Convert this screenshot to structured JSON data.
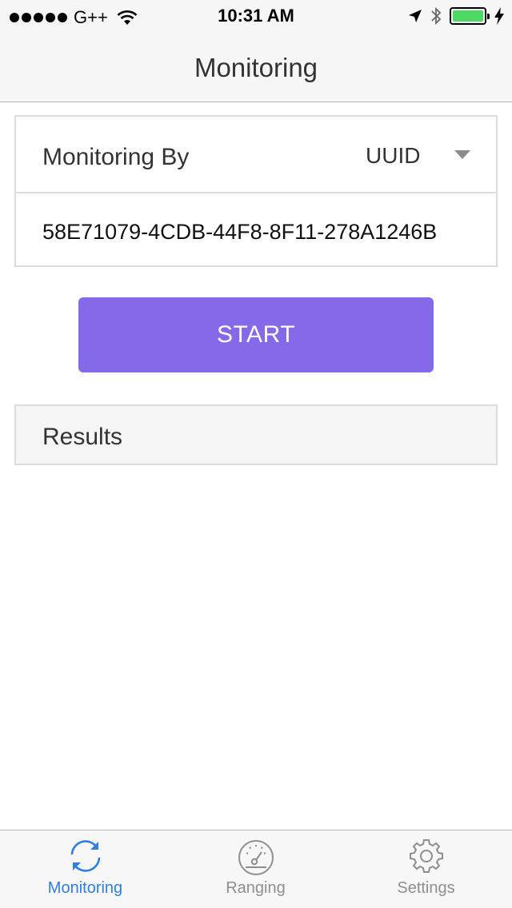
{
  "status_bar": {
    "carrier": "G++",
    "time": "10:31 AM"
  },
  "nav": {
    "title": "Monitoring"
  },
  "form": {
    "select_label": "Monitoring By",
    "select_value": "UUID",
    "uuid_value": "58E71079-4CDB-44F8-8F11-278A1246B"
  },
  "start_button": {
    "label": "START"
  },
  "results": {
    "title": "Results"
  },
  "tabs": [
    {
      "label": "Monitoring",
      "icon": "refresh-icon",
      "active": true
    },
    {
      "label": "Ranging",
      "icon": "speedometer-icon",
      "active": false
    },
    {
      "label": "Settings",
      "icon": "gear-icon",
      "active": false
    }
  ],
  "colors": {
    "accent": "#8569e9",
    "tab_active": "#2f7fe0",
    "tab_inactive": "#8e8e8e",
    "battery": "#4cd964"
  }
}
